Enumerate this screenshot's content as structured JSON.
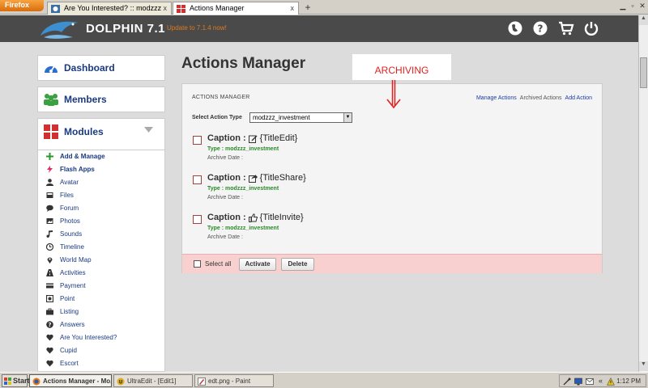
{
  "browser": {
    "menu_button": "Firefox",
    "tabs": [
      {
        "title": "Are You Interested? :: modzzz",
        "active": false
      },
      {
        "title": "Actions Manager",
        "active": true
      }
    ],
    "new_tab": "+",
    "close_glyph": "x"
  },
  "header": {
    "brand": "DOLPHIN 7.1",
    "update_link": "Update to 7.1.4 now!",
    "icons": [
      "globe-icon",
      "help-icon",
      "cart-icon",
      "power-icon"
    ]
  },
  "sidebar": {
    "sections": [
      {
        "label": "Dashboard",
        "icon": "dashboard-icon"
      },
      {
        "label": "Members",
        "icon": "members-icon"
      },
      {
        "label": "Modules",
        "icon": "modules-icon"
      }
    ],
    "modules": [
      {
        "label": "Add & Manage",
        "icon": "plus-icon"
      },
      {
        "label": "Flash Apps",
        "icon": "bolt-icon"
      },
      {
        "label": "Avatar",
        "icon": "user-icon"
      },
      {
        "label": "Files",
        "icon": "file-icon"
      },
      {
        "label": "Forum",
        "icon": "comments-icon"
      },
      {
        "label": "Photos",
        "icon": "picture-icon"
      },
      {
        "label": "Sounds",
        "icon": "music-icon"
      },
      {
        "label": "Timeline",
        "icon": "clock-icon"
      },
      {
        "label": "World Map",
        "icon": "map-marker-icon"
      },
      {
        "label": "Activities",
        "icon": "road-icon"
      },
      {
        "label": "Payment",
        "icon": "credit-card-icon"
      },
      {
        "label": "Point",
        "icon": "point-icon"
      },
      {
        "label": "Listing",
        "icon": "briefcase-icon"
      },
      {
        "label": "Answers",
        "icon": "question-icon"
      },
      {
        "label": "Are You Interested?",
        "icon": "heart-icon"
      },
      {
        "label": "Cupid",
        "icon": "heart-icon"
      },
      {
        "label": "Escort",
        "icon": "heart-icon"
      }
    ]
  },
  "main": {
    "title": "Actions Manager",
    "annotation": "ARCHIVING",
    "panel": {
      "header": "ACTIONS MANAGER",
      "links": [
        {
          "label": "Manage Actions",
          "current": false
        },
        {
          "label": "Archived Actions",
          "current": true
        },
        {
          "label": "Add Action",
          "current": false
        }
      ],
      "select_label": "Select Action Type",
      "select_value": "modzzz_investment",
      "actions": [
        {
          "caption": "Caption :",
          "icon": "edit-icon",
          "title": "{TitleEdit}",
          "type": "Type : modzzz_investment",
          "archive_date": "Archive Date :"
        },
        {
          "caption": "Caption :",
          "icon": "share-icon",
          "title": "{TitleShare}",
          "type": "Type : modzzz_investment",
          "archive_date": "Archive Date :"
        },
        {
          "caption": "Caption :",
          "icon": "thumbs-up-icon",
          "title": "{TitleInvite}",
          "type": "Type : modzzz_investment",
          "archive_date": "Archive Date :"
        }
      ],
      "select_all": "Select all",
      "activate_button": "Activate",
      "delete_button": "Delete"
    }
  },
  "taskbar": {
    "start": "Start",
    "tasks": [
      {
        "label": "Actions Manager - Mo...",
        "active": true
      },
      {
        "label": "UltraEdit - [Edit1]",
        "active": false
      },
      {
        "label": "edt.png - Paint",
        "active": false
      }
    ],
    "tray_toggle": "«",
    "clock": "1:12 PM"
  }
}
